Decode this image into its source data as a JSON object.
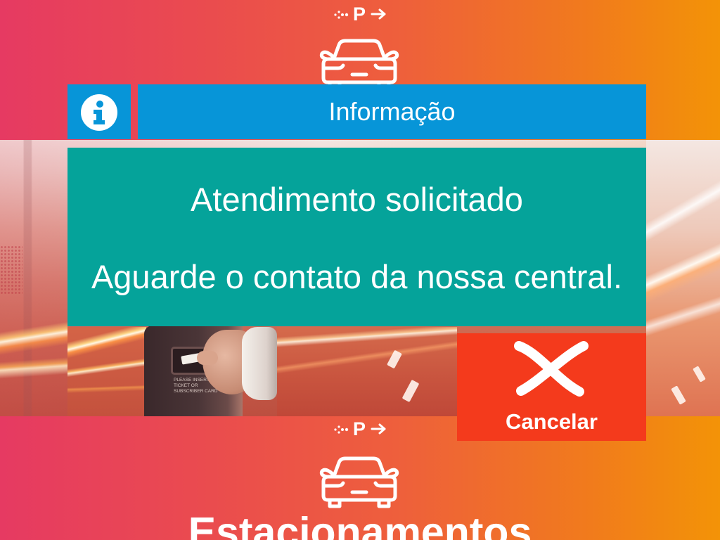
{
  "screen": {
    "background_colors": [
      "#e63a62",
      "#ee5f3c",
      "#f39307"
    ]
  },
  "header_logo": {
    "letter": "P",
    "icons": [
      "dots-icon",
      "arrow-right-icon",
      "car-icon"
    ]
  },
  "photo": {
    "machine_label": [
      "PLEASE INSERT",
      "TICKET OR",
      "SUBSCRIBER CARD"
    ]
  },
  "dialog": {
    "icon": "info-icon",
    "title": "Informação",
    "message_line_1": "Atendimento solicitado",
    "message_line_2": "Aguarde o contato da nossa central.",
    "colors": {
      "header": "#0795d8",
      "message": "#05a39a",
      "cancel": "#f43a1c"
    }
  },
  "cancel_button": {
    "label": "Cancelar",
    "icon": "close-icon"
  },
  "footer_logo": {
    "letter": "P",
    "brand": "Estacionamentos",
    "icons": [
      "dots-icon",
      "arrow-right-icon",
      "car-icon"
    ]
  }
}
